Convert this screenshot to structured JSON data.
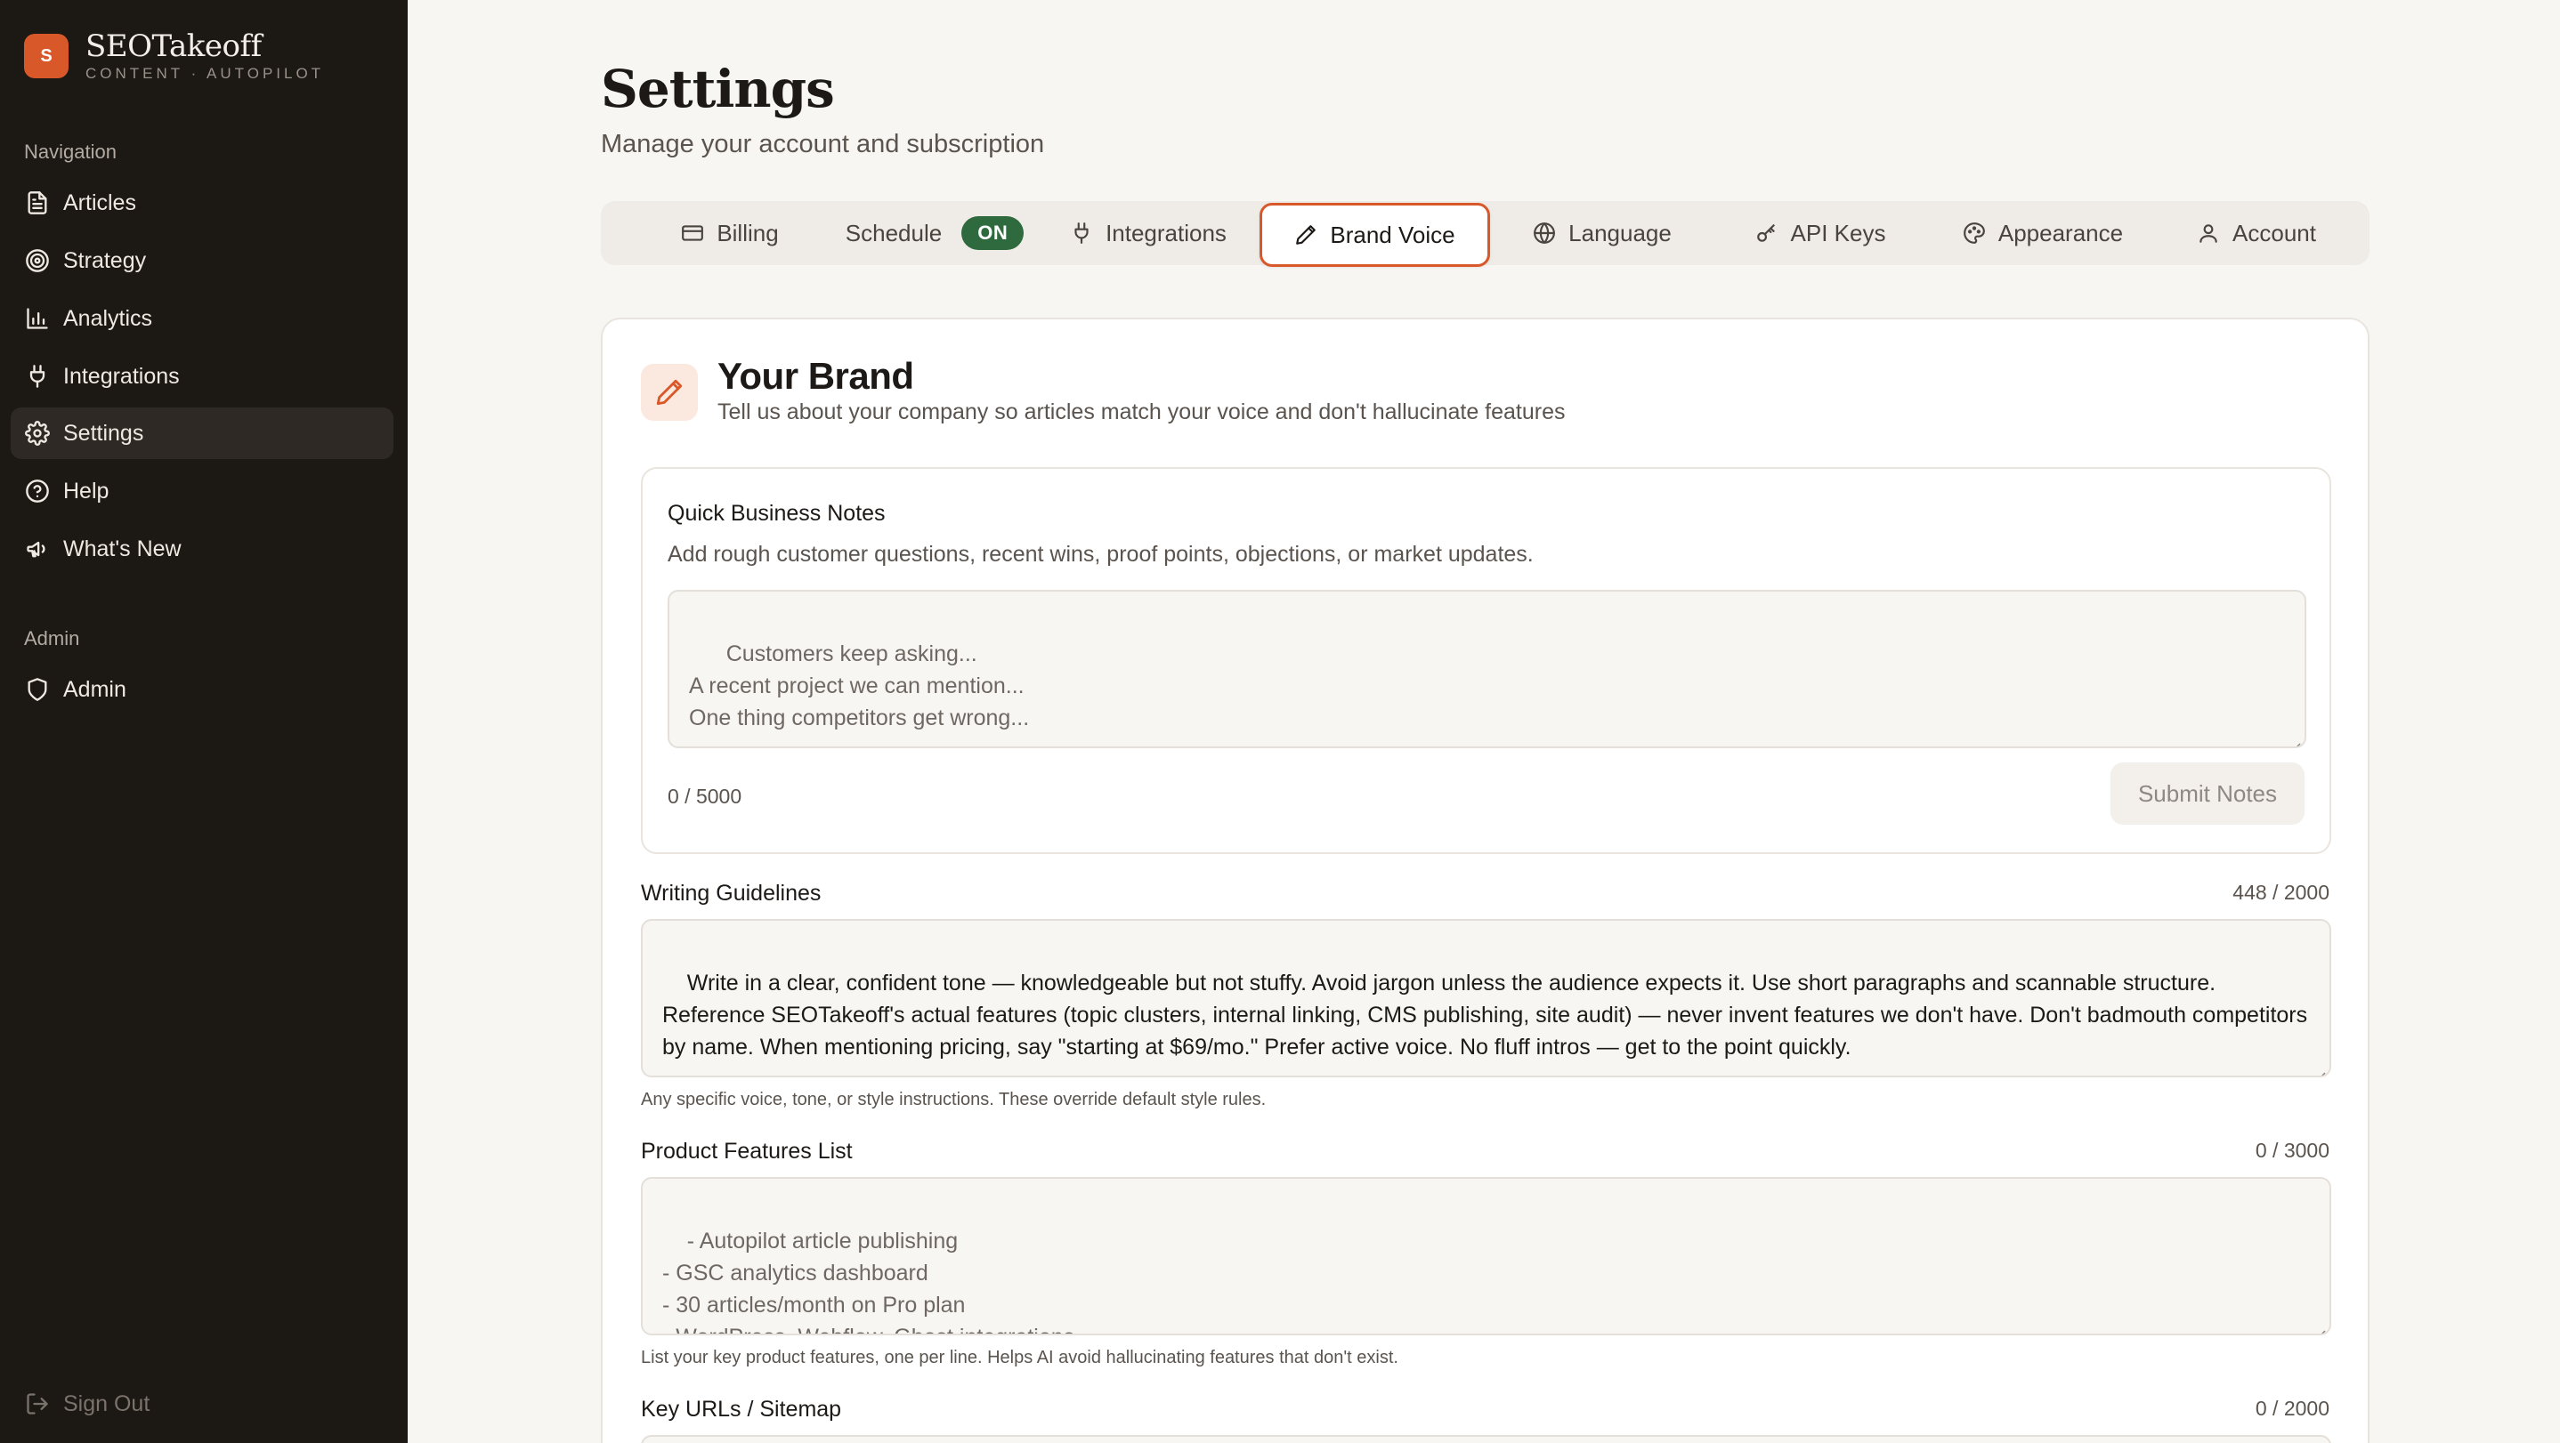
{
  "brand": {
    "logo_letter": "S",
    "name": "SEOTakeoff",
    "tagline": "CONTENT · AUTOPILOT",
    "accent_color": "#d9582a"
  },
  "sidebar": {
    "nav_label": "Navigation",
    "items": [
      {
        "label": "Articles",
        "icon": "document-icon"
      },
      {
        "label": "Strategy",
        "icon": "target-icon"
      },
      {
        "label": "Analytics",
        "icon": "bar-chart-icon"
      },
      {
        "label": "Integrations",
        "icon": "plug-icon"
      },
      {
        "label": "Settings",
        "icon": "gear-icon",
        "active": true
      },
      {
        "label": "Help",
        "icon": "help-circle-icon"
      },
      {
        "label": "What's New",
        "icon": "megaphone-icon"
      }
    ],
    "admin_label": "Admin",
    "admin_item": "Admin",
    "sign_out": "Sign Out"
  },
  "header": {
    "title": "Settings",
    "subtitle": "Manage your account and subscription"
  },
  "tabs": [
    {
      "label": "Billing",
      "icon": "credit-card-icon"
    },
    {
      "label": "Schedule",
      "badge": "ON"
    },
    {
      "label": "Integrations",
      "icon": "plug-icon"
    },
    {
      "label": "Brand Voice",
      "icon": "pencil-icon",
      "active": true
    },
    {
      "label": "Language",
      "icon": "globe-icon"
    },
    {
      "label": "API Keys",
      "icon": "key-icon"
    },
    {
      "label": "Appearance",
      "icon": "palette-icon"
    },
    {
      "label": "Account",
      "icon": "user-icon"
    }
  ],
  "card": {
    "title": "Your Brand",
    "description": "Tell us about your company so articles match your voice and don't hallucinate features",
    "notes": {
      "title": "Quick Business Notes",
      "help": "Add rough customer questions, recent wins, proof points, objections, or market updates.",
      "placeholder": "Customers keep asking...\nA recent project we can mention...\nOne thing competitors get wrong...",
      "count": "0 / 5000",
      "submit_label": "Submit Notes"
    },
    "guidelines": {
      "label": "Writing Guidelines",
      "count": "448 / 2000",
      "value": "Write in a clear, confident tone — knowledgeable but not stuffy. Avoid jargon unless the audience expects it. Use short paragraphs and scannable structure. Reference SEOTakeoff's actual features (topic clusters, internal linking, CMS publishing, site audit) — never invent features we don't have. Don't badmouth competitors by name. When mentioning pricing, say \"starting at $69/mo.\" Prefer active voice. No fluff intros — get to the point quickly.",
      "help": "Any specific voice, tone, or style instructions. These override default style rules."
    },
    "features": {
      "label": "Product Features List",
      "count": "0 / 3000",
      "placeholder": "- Autopilot article publishing\n- GSC analytics dashboard\n- 30 articles/month on Pro plan\n- WordPress, Webflow, Ghost integrations",
      "help": "List your key product features, one per line. Helps AI avoid hallucinating features that don't exist."
    },
    "urls": {
      "label": "Key URLs / Sitemap",
      "count": "0 / 2000"
    }
  }
}
